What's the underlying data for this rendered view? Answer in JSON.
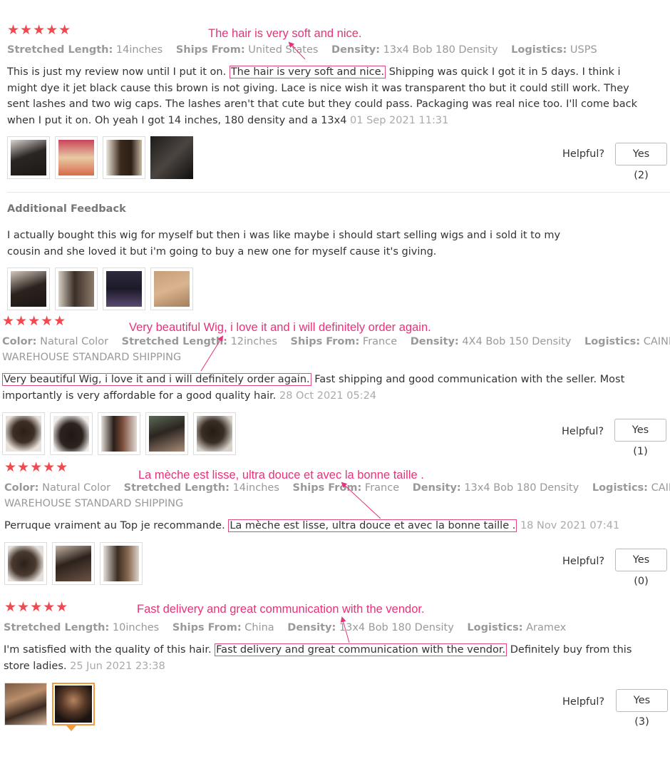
{
  "reviews": [
    {
      "stars": "★★★★★",
      "meta": [
        {
          "label": "Stretched Length:",
          "value": "14inches"
        },
        {
          "label": "Ships From:",
          "value": "United States"
        },
        {
          "label": "Density:",
          "value": "13x4 Bob 180 Density"
        },
        {
          "label": "Logistics:",
          "value": "USPS"
        }
      ],
      "text_before": "This is just my review now until I put it on. ",
      "highlight": "The hair is very soft and nice.",
      "text_after": " Shipping was quick I got it in 5 days. I think i might dye it jet black cause this brown is not giving. Lace is nice wish it was transparent tho but it could still work. They sent lashes and two wig caps. The lashes aren't that cute but they could pass. Packaging was real nice too. I'll come back when I put it on. Oh yeah I got 14 inches, 180 density and a 13x4",
      "date": "01 Sep 2021 11:31",
      "annotation": "The hair is very soft and nice.",
      "helpful_label": "Helpful?",
      "yes_label": "Yes (2)",
      "photos": [
        "photo-1",
        "photo-2",
        "photo-3",
        "photo-4"
      ]
    },
    {
      "additional_title": "Additional Feedback",
      "additional_text": "I actually bought this wig for myself but then i was like maybe i should start selling wigs and i sold it to my cousin and she loved it but i'm going to buy a new one for myself cause it's giving.",
      "photos": [
        "photo-1",
        "photo-2",
        "photo-3",
        "photo-4"
      ]
    },
    {
      "stars": "★★★★★",
      "meta": [
        {
          "label": "Color:",
          "value": "Natural Color"
        },
        {
          "label": "Stretched Length:",
          "value": "12inches"
        },
        {
          "label": "Ships From:",
          "value": "France"
        },
        {
          "label": "Density:",
          "value": "4X4 Bob 150 Density"
        },
        {
          "label": "Logistics:",
          "value": "CAINIAO"
        }
      ],
      "meta_wrap": "WAREHOUSE STANDARD SHIPPING",
      "text_before": "",
      "highlight": "Very beautiful Wig, i love it and i will definitely order again.",
      "text_after": " Fast shipping and good communication with the seller. Most importantly is very affordable for a good quality hair.",
      "date": "28 Oct 2021 05:24",
      "annotation": "Very beautiful Wig, i love it and i will definitely order again.",
      "helpful_label": "Helpful?",
      "yes_label": "Yes (1)",
      "photos": [
        "photo-1",
        "photo-2",
        "photo-3",
        "photo-4",
        "photo-5"
      ]
    },
    {
      "stars": "★★★★★",
      "meta": [
        {
          "label": "Color:",
          "value": "Natural Color"
        },
        {
          "label": "Stretched Length:",
          "value": "14inches"
        },
        {
          "label": "Ships From:",
          "value": "France"
        },
        {
          "label": "Density:",
          "value": "13x4 Bob 180 Density"
        },
        {
          "label": "Logistics:",
          "value": "CAINIAO"
        }
      ],
      "meta_wrap": "WAREHOUSE STANDARD SHIPPING",
      "text_before": "Perruque vraiment au Top je recommande. ",
      "highlight": "La mèche est lisse, ultra douce et avec la bonne taille .",
      "text_after": " ",
      "date": "18 Nov 2021 07:41",
      "annotation": "La mèche est lisse, ultra douce et avec la bonne taille .",
      "helpful_label": "Helpful?",
      "yes_label": "Yes (0)",
      "photos": [
        "photo-1",
        "photo-2",
        "photo-3"
      ]
    },
    {
      "stars": "★★★★★",
      "meta": [
        {
          "label": "Stretched Length:",
          "value": "10inches"
        },
        {
          "label": "Ships From:",
          "value": "China"
        },
        {
          "label": "Density:",
          "value": "13x4 Bob 180 Density"
        },
        {
          "label": "Logistics:",
          "value": "Aramex"
        }
      ],
      "text_before": "I'm satisfied with the quality of this hair. ",
      "highlight": "Fast delivery and great communication with the vendor.",
      "text_after": " Definitely buy from this store ladies.",
      "date": "25 Jun 2021 23:38",
      "annotation": "Fast delivery and great communication with the vendor.",
      "helpful_label": "Helpful?",
      "yes_label": "Yes (3)",
      "photos": [
        "photo-1",
        "photo-2"
      ]
    }
  ],
  "colors": {
    "star": "#f0494f",
    "annotation": "#e8317a",
    "selected_thumb": "#f29b3b"
  }
}
